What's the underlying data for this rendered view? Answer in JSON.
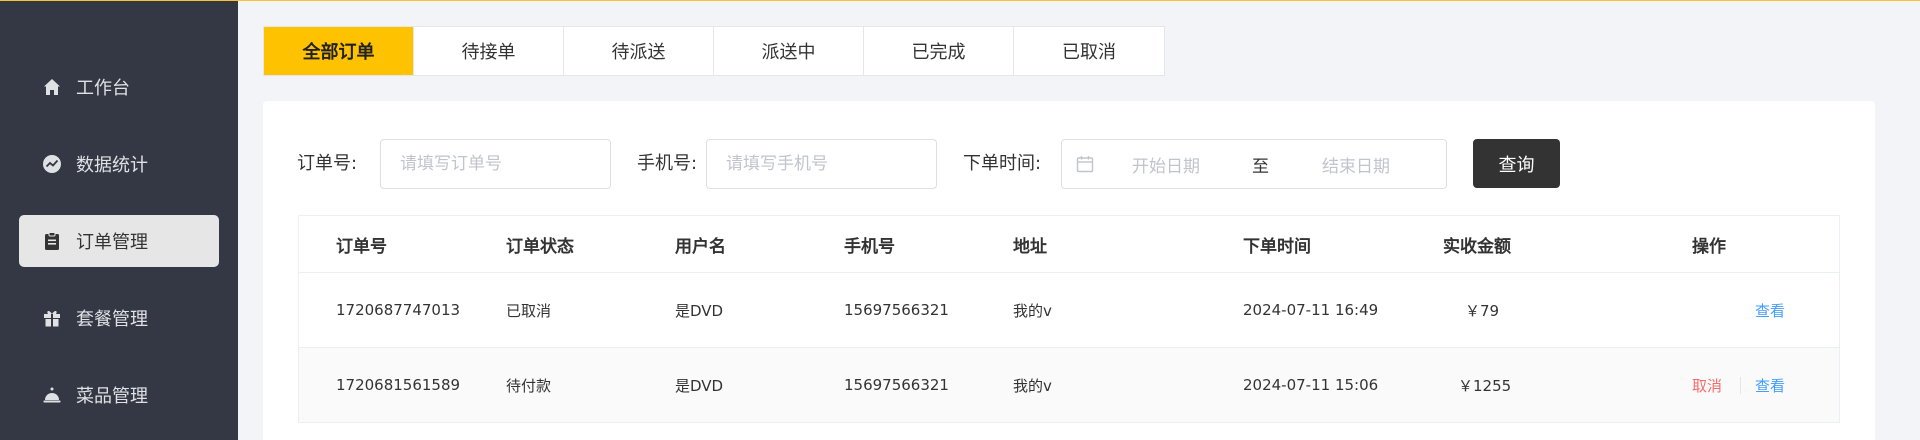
{
  "sidebar": {
    "items": [
      {
        "label": "工作台",
        "icon": "home-icon",
        "active": false
      },
      {
        "label": "数据统计",
        "icon": "chart-icon",
        "active": false
      },
      {
        "label": "订单管理",
        "icon": "clipboard-icon",
        "active": true
      },
      {
        "label": "套餐管理",
        "icon": "gift-icon",
        "active": false
      },
      {
        "label": "菜品管理",
        "icon": "cloche-icon",
        "active": false
      }
    ]
  },
  "tabs": [
    {
      "label": "全部订单",
      "active": true
    },
    {
      "label": "待接单",
      "active": false
    },
    {
      "label": "待派送",
      "active": false
    },
    {
      "label": "派送中",
      "active": false
    },
    {
      "label": "已完成",
      "active": false
    },
    {
      "label": "已取消",
      "active": false
    }
  ],
  "filters": {
    "order_no_label": "订单号:",
    "order_no_placeholder": "请填写订单号",
    "phone_label": "手机号:",
    "phone_placeholder": "请填写手机号",
    "time_label": "下单时间:",
    "start_placeholder": "开始日期",
    "range_sep": "至",
    "end_placeholder": "结束日期",
    "search_label": "查询"
  },
  "table": {
    "headers": [
      "订单号",
      "订单状态",
      "用户名",
      "手机号",
      "地址",
      "下单时间",
      "实收金额",
      "操作"
    ],
    "rows": [
      {
        "order_no": "1720687747013",
        "status": "已取消",
        "user": "是DVD",
        "phone": "15697566321",
        "address": "我的v",
        "time": "2024-07-11 16:49",
        "amount": "￥79",
        "cancel": "",
        "view": "查看"
      },
      {
        "order_no": "1720681561589",
        "status": "待付款",
        "user": "是DVD",
        "phone": "15697566321",
        "address": "我的v",
        "time": "2024-07-11 15:06",
        "amount": "￥1255",
        "cancel": "取消",
        "view": "查看"
      }
    ]
  },
  "colors": {
    "accent": "#ffc200",
    "sidebar_bg": "#343744",
    "search_button": "#333333",
    "link": "#419eff",
    "danger": "#f56c6c"
  }
}
